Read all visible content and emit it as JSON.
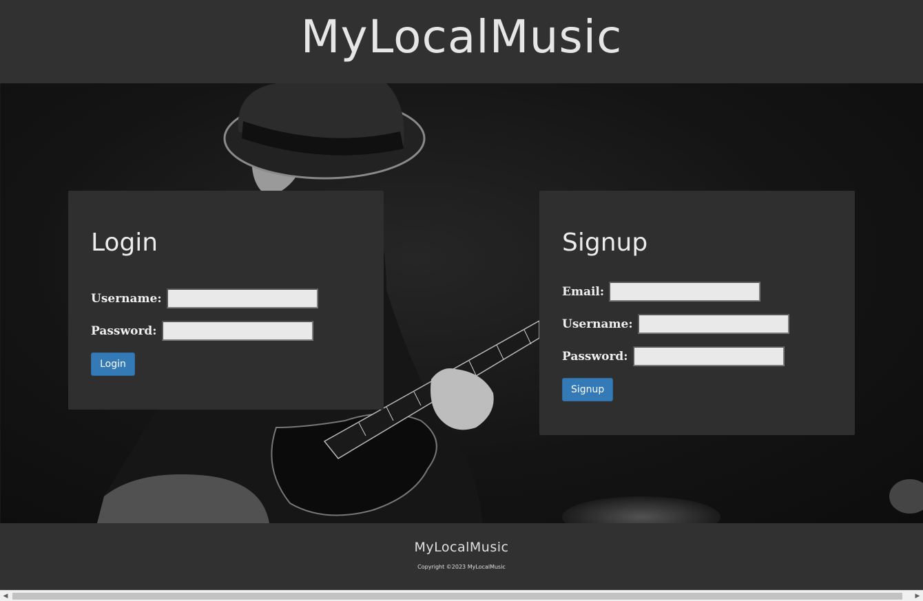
{
  "header": {
    "title": "MyLocalMusic"
  },
  "hero": {
    "background_image": "guitarist-playing-guitar-photo"
  },
  "login": {
    "heading": "Login",
    "username_label": "Username:",
    "username_value": "",
    "password_label": "Password:",
    "password_value": "",
    "button_label": "Login"
  },
  "signup": {
    "heading": "Signup",
    "email_label": "Email:",
    "email_value": "",
    "username_label": "Username:",
    "username_value": "",
    "password_label": "Password:",
    "password_value": "",
    "button_label": "Signup"
  },
  "footer": {
    "title": "MyLocalMusic",
    "copyright": "Copyright ©2023 MyLocalMusic"
  },
  "scrollbar": {
    "left_icon": "arrow-left-icon",
    "right_icon": "arrow-right-icon"
  },
  "colors": {
    "header_bg": "#313131",
    "panel_bg": "#2f2f2f",
    "button_blue": "#337ab7",
    "input_bg": "#e9e9e9"
  }
}
